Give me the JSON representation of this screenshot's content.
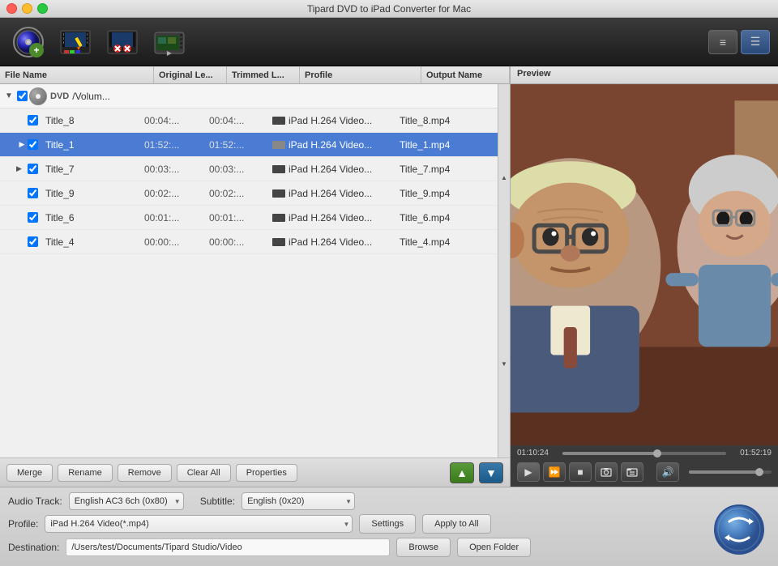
{
  "window": {
    "title": "Tipard DVD to iPad Converter for Mac"
  },
  "toolbar": {
    "icons": [
      "load-dvd",
      "video-edit",
      "trim",
      "clip"
    ],
    "view_list_label": "≡",
    "view_detail_label": "☰"
  },
  "file_list": {
    "columns": [
      "File Name",
      "Original Le...",
      "Trimmed L...",
      "Profile",
      "Output Name"
    ],
    "dvd_root": {
      "path": "/Volum...",
      "checked": true
    },
    "files": [
      {
        "name": "Title_8",
        "original": "00:04:...",
        "trimmed": "00:04:...",
        "profile": "iPad H.264 Video...",
        "output": "Title_8.mp4",
        "checked": true,
        "selected": false
      },
      {
        "name": "Title_1",
        "original": "01:52:...",
        "trimmed": "01:52:...",
        "profile": "iPad H.264 Video...",
        "output": "Title_1.mp4",
        "checked": true,
        "selected": true,
        "has_play": true
      },
      {
        "name": "Title_7",
        "original": "00:03:...",
        "trimmed": "00:03:...",
        "profile": "iPad H.264 Video...",
        "output": "Title_7.mp4",
        "checked": true,
        "selected": false
      },
      {
        "name": "Title_9",
        "original": "00:02:...",
        "trimmed": "00:02:...",
        "profile": "iPad H.264 Video...",
        "output": "Title_9.mp4",
        "checked": true,
        "selected": false
      },
      {
        "name": "Title_6",
        "original": "00:01:...",
        "trimmed": "00:01:...",
        "profile": "iPad H.264 Video...",
        "output": "Title_6.mp4",
        "checked": true,
        "selected": false
      },
      {
        "name": "Title_4",
        "original": "00:00:...",
        "trimmed": "00:00:...",
        "profile": "iPad H.264 Video...",
        "output": "Title_4.mp4",
        "checked": true,
        "selected": false
      }
    ],
    "buttons": {
      "merge": "Merge",
      "rename": "Rename",
      "remove": "Remove",
      "clear_all": "Clear All",
      "properties": "Properties"
    }
  },
  "preview": {
    "label": "Preview",
    "time_current": "01:10:24",
    "time_total": "01:52:19"
  },
  "settings": {
    "audio_track_label": "Audio Track:",
    "audio_track_value": "English AC3 6ch (0x80)",
    "subtitle_label": "Subtitle:",
    "subtitle_value": "English (0x20)",
    "profile_label": "Profile:",
    "profile_value": "iPad H.264 Video(*.mp4)",
    "destination_label": "Destination:",
    "destination_value": "/Users/test/Documents/Tipard Studio/Video",
    "settings_btn": "Settings",
    "apply_to_all_btn": "Apply to All",
    "browse_btn": "Browse",
    "open_folder_btn": "Open Folder"
  }
}
